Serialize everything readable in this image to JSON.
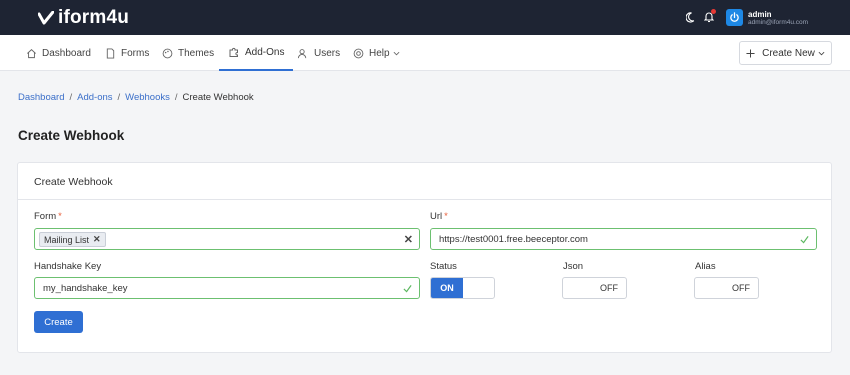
{
  "app": {
    "logo_text": "iform4u",
    "user_name": "admin",
    "user_email": "admin@iform4u.com"
  },
  "nav": {
    "items": [
      {
        "label": "Dashboard",
        "icon": "home-icon"
      },
      {
        "label": "Forms",
        "icon": "document-icon"
      },
      {
        "label": "Themes",
        "icon": "palette-icon"
      },
      {
        "label": "Add-Ons",
        "icon": "puzzle-icon",
        "active": true
      },
      {
        "label": "Users",
        "icon": "users-icon"
      },
      {
        "label": "Help",
        "icon": "lifebuoy-icon"
      }
    ],
    "create_new": "Create New"
  },
  "breadcrumb": {
    "items": [
      "Dashboard",
      "Add-ons",
      "Webhooks"
    ],
    "current": "Create Webhook"
  },
  "page": {
    "title": "Create Webhook",
    "card_title": "Create Webhook"
  },
  "form": {
    "form_label": "Form",
    "form_value": "Mailing List",
    "url_label": "Url",
    "url_value": "https://test0001.free.beeceptor.com",
    "handshake_label": "Handshake Key",
    "handshake_value": "my_handshake_key",
    "status_label": "Status",
    "status_value": "ON",
    "json_label": "Json",
    "json_value": "OFF",
    "alias_label": "Alias",
    "alias_value": "OFF",
    "submit_label": "Create",
    "required_mark": "*",
    "tag_remove": "✕",
    "clear_mark": "✕"
  },
  "colors": {
    "topbar": "#1e2433",
    "accent": "#2f6fd3",
    "valid": "#6cc070",
    "required": "#e8603c"
  }
}
